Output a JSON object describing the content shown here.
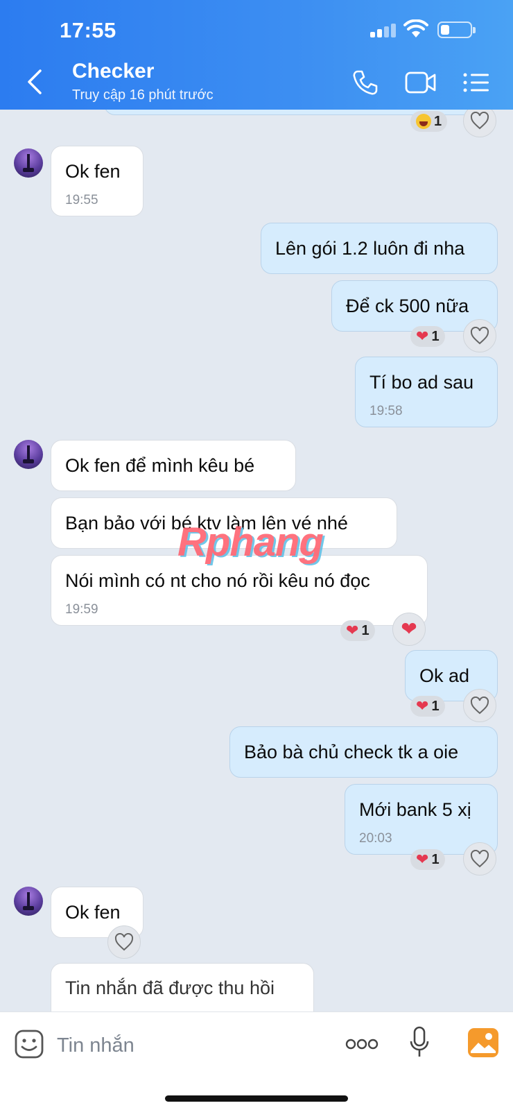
{
  "status_bar": {
    "time": "17:55"
  },
  "header": {
    "title": "Checker",
    "subtitle": "Truy cập 16 phút trước",
    "accent_color": "#3a8cf2",
    "icons": [
      "back-chevron-icon",
      "phone-icon",
      "video-camera-icon",
      "menu-list-icon"
    ]
  },
  "messages": [
    {
      "side": "out",
      "text": "",
      "reactions": [
        {
          "emoji": "laughing-emoji",
          "count": "1"
        }
      ]
    },
    {
      "side": "in",
      "text": "Ok fen",
      "time": "19:55"
    },
    {
      "side": "out",
      "text": "Lên gói 1.2 luôn đi nha"
    },
    {
      "side": "out",
      "text": "Để ck 500 nữa",
      "reactions": [
        {
          "emoji": "heart",
          "count": "1"
        }
      ]
    },
    {
      "side": "out",
      "text": "Tí bo ad sau",
      "time": "19:58"
    },
    {
      "side": "in",
      "text": "Ok fen để mình kêu bé"
    },
    {
      "side": "in",
      "text": "Bạn bảo với bé ktv làm lên vé nhé"
    },
    {
      "side": "in",
      "text": "Nói mình có nt cho nó rồi kêu nó đọc",
      "time": "19:59",
      "reactions": [
        {
          "emoji": "heart",
          "count": "1"
        }
      ]
    },
    {
      "side": "out",
      "text": "Ok ad",
      "reactions": [
        {
          "emoji": "heart",
          "count": "1"
        }
      ]
    },
    {
      "side": "out",
      "text": "Bảo bà chủ check tk a oie"
    },
    {
      "side": "out",
      "text": "Mới bank 5 xị",
      "time": "20:03",
      "reactions": [
        {
          "emoji": "heart",
          "count": "1"
        }
      ]
    },
    {
      "side": "in",
      "text": "Ok fen"
    },
    {
      "side": "in",
      "text": "Tin nhắn đã được thu hồi"
    }
  ],
  "watermark": "Rphang",
  "input": {
    "placeholder": "Tin nhắn"
  },
  "colors": {
    "outgoing_bubble": "#d6ecfd",
    "incoming_bubble": "#ffffff",
    "heart": "#e53950",
    "background": "#e3e9f1"
  }
}
